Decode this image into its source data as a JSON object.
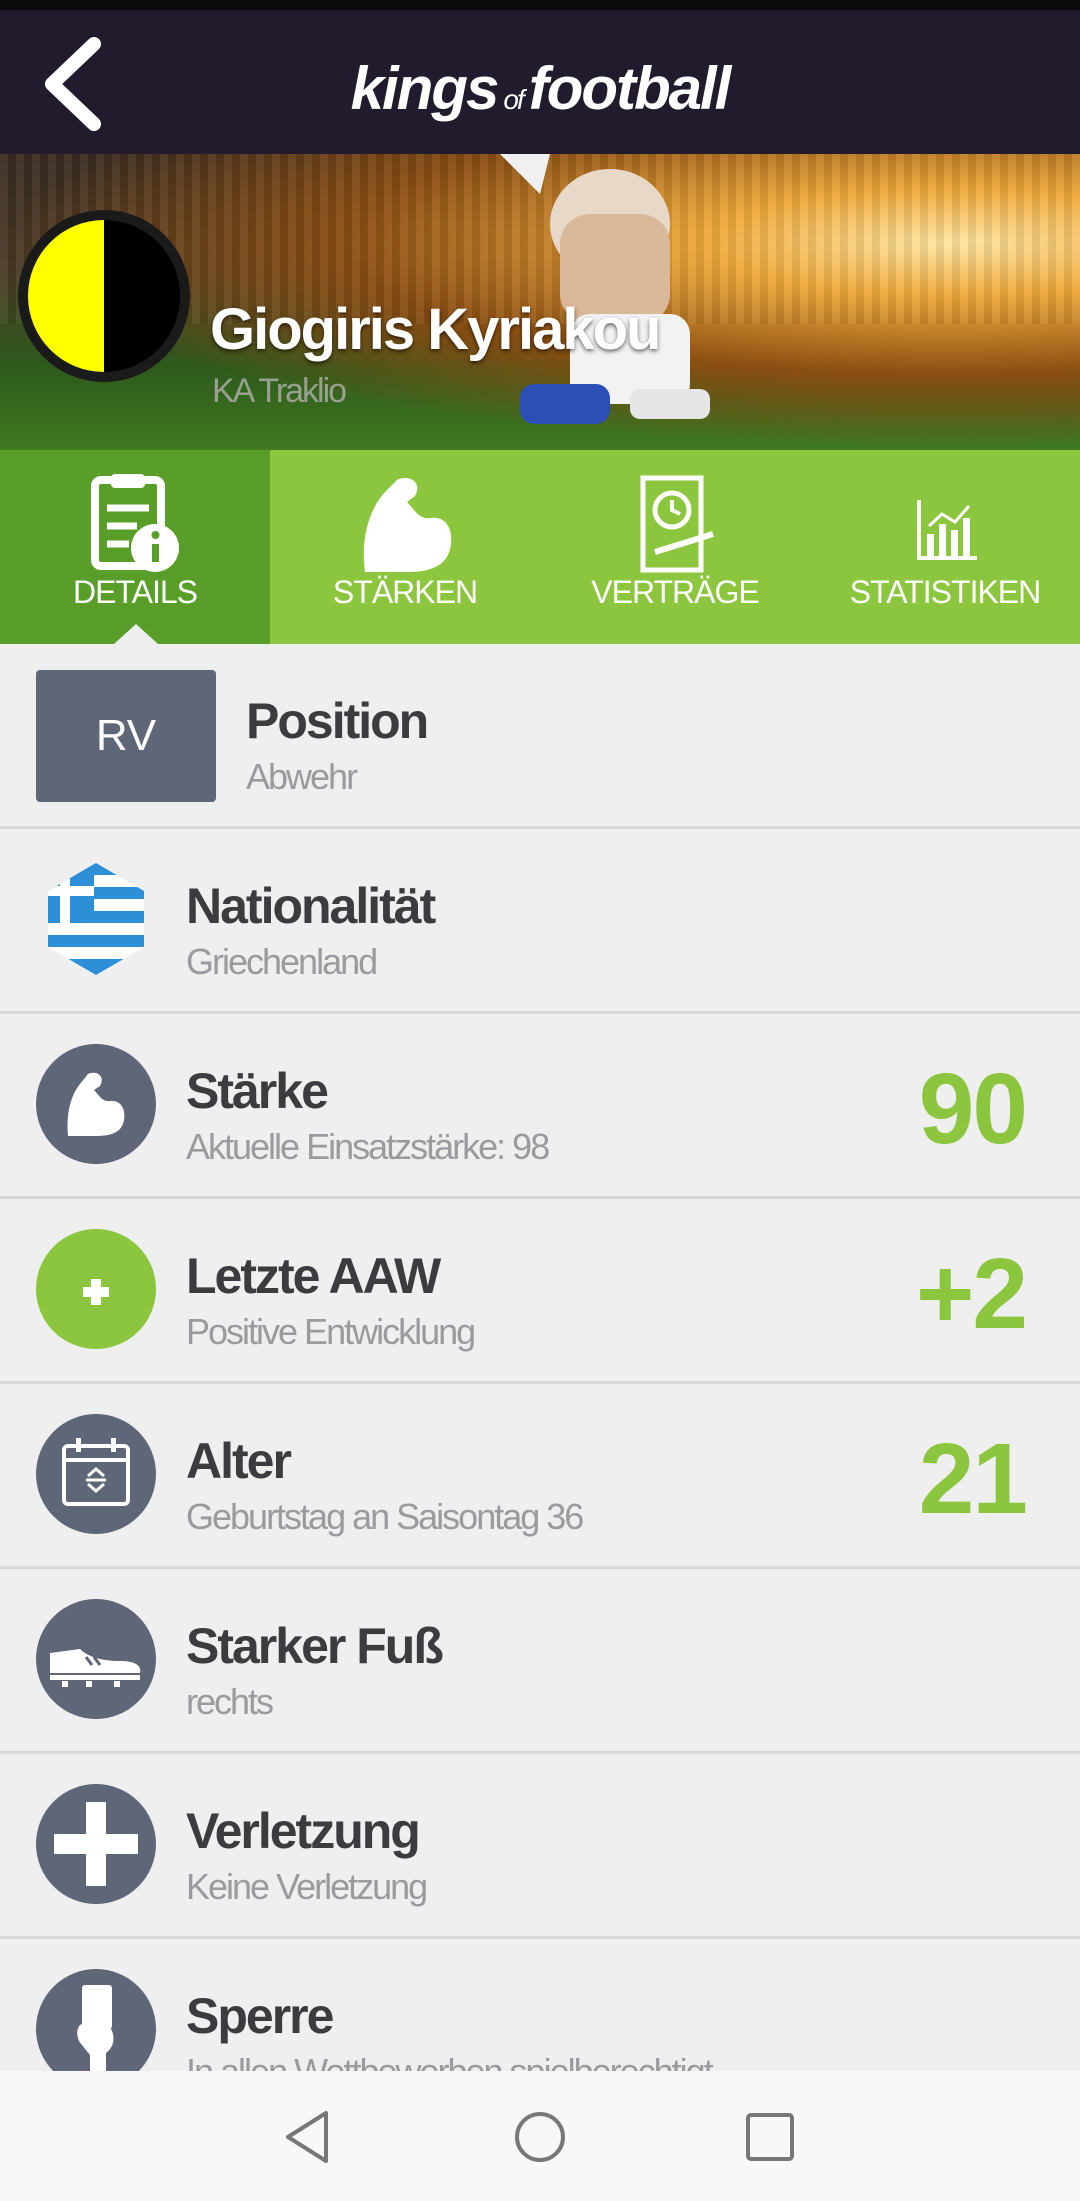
{
  "appbar": {
    "logo_left": "kings",
    "logo_of": "of",
    "logo_right": "football",
    "back_icon": "back-arrow-icon"
  },
  "hero": {
    "player_name": "Giogiris Kyriakou",
    "club_name": "KA Traklio",
    "club_colors": [
      "#ffff00",
      "#000000"
    ]
  },
  "tabs": [
    {
      "label": "DETAILS",
      "icon": "document-info-icon",
      "active": true
    },
    {
      "label": "STÄRKEN",
      "icon": "flexed-arm-icon",
      "active": false
    },
    {
      "label": "VERTRÄGE",
      "icon": "contract-clock-icon",
      "active": false
    },
    {
      "label": "STATISTIKEN",
      "icon": "bar-chart-icon",
      "active": false
    }
  ],
  "details": {
    "position": {
      "badge": "RV",
      "title": "Position",
      "subtitle": "Abwehr"
    },
    "nationality": {
      "title": "Nationalität",
      "subtitle": "Griechenland",
      "icon": "greece-flag-icon"
    },
    "strength": {
      "title": "Stärke",
      "subtitle": "Aktuelle Einsatzstärke: 98",
      "value": "90",
      "icon": "flexed-arm-icon"
    },
    "last_aaw": {
      "title": "Letzte AAW",
      "subtitle": "Positive Entwicklung",
      "value": "+2",
      "icon": "plus-icon"
    },
    "age": {
      "title": "Alter",
      "subtitle": "Geburtstag an Saisontag 36",
      "value": "21",
      "icon": "calendar-icon"
    },
    "foot": {
      "title": "Starker Fuß",
      "subtitle": "rechts",
      "icon": "football-boot-icon"
    },
    "injury": {
      "title": "Verletzung",
      "subtitle": "Keine Verletzung",
      "icon": "medical-cross-icon"
    },
    "suspension": {
      "title": "Sperre",
      "subtitle": "In allen Wettbewerben spielberechtigt",
      "icon": "referee-card-icon"
    }
  },
  "colors": {
    "accent_green": "#8cc63f",
    "tab_active": "#5a9e2a",
    "icon_gray": "#5f6677",
    "appbar": "#211b2d"
  },
  "navbar": {
    "back": "nav-back-icon",
    "home": "nav-home-icon",
    "recents": "nav-recents-icon"
  }
}
